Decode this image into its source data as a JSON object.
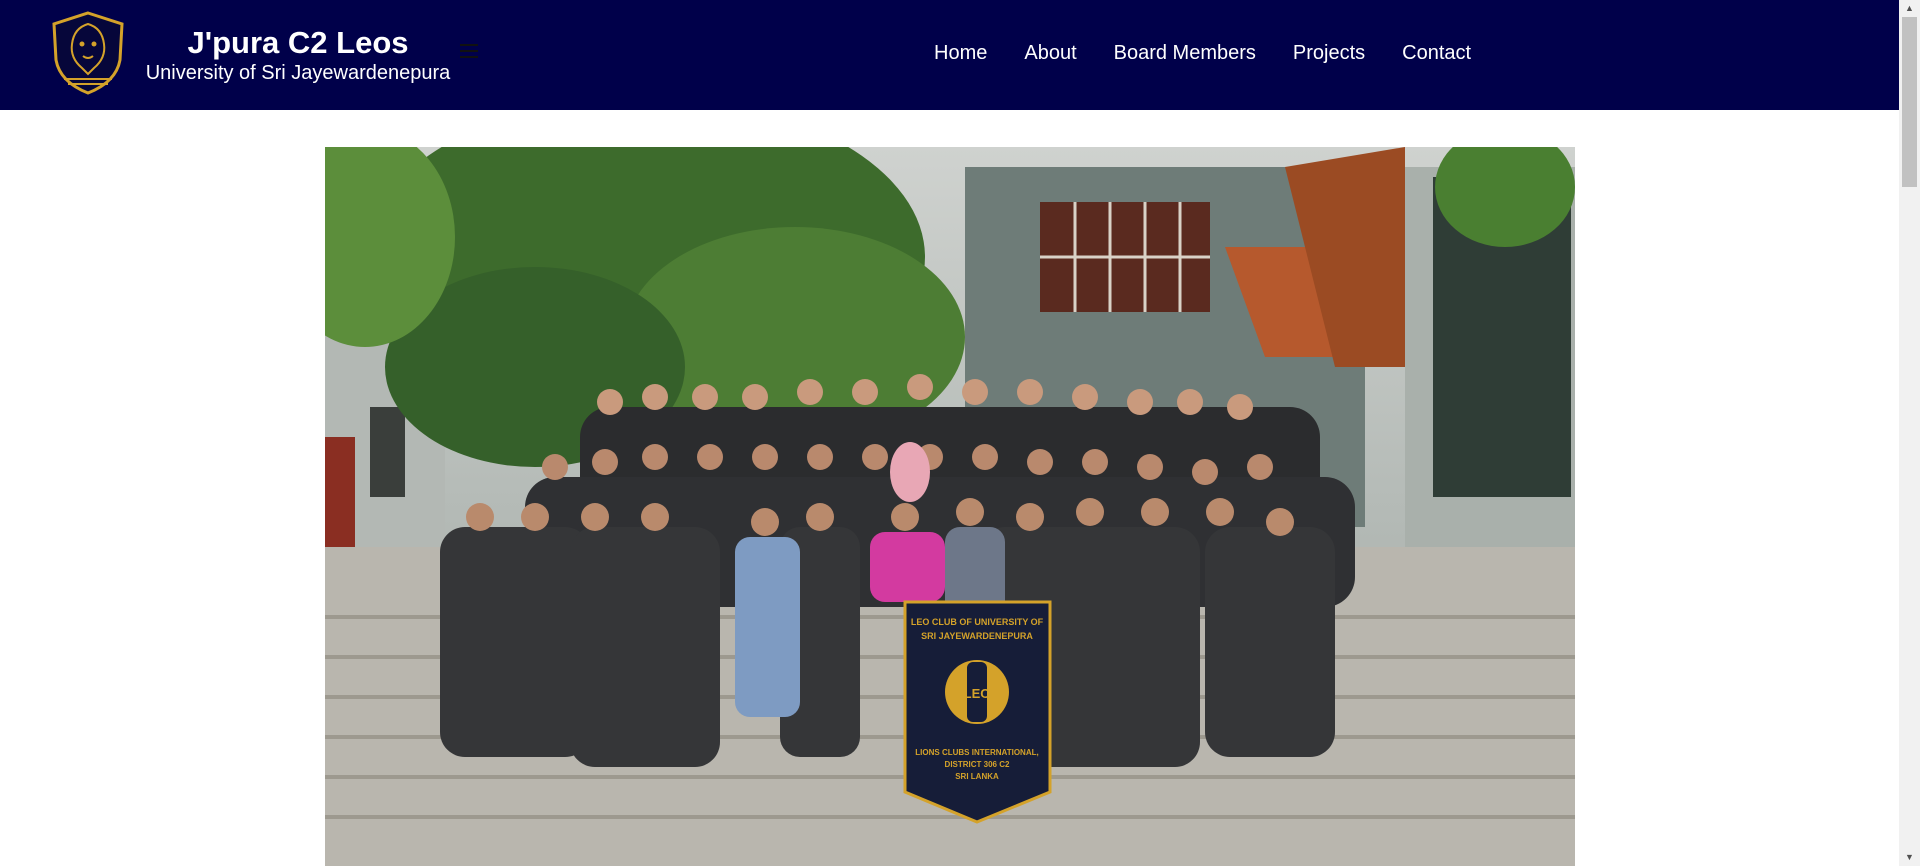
{
  "brand": {
    "title": "J'pura C2 Leos",
    "subtitle": "University of Sri Jayewardenepura",
    "logo_icon": "lion-shield-logo-icon"
  },
  "nav": {
    "items": [
      {
        "label": "Home"
      },
      {
        "label": "About"
      },
      {
        "label": "Board Members"
      },
      {
        "label": "Projects"
      },
      {
        "label": "Contact"
      }
    ]
  },
  "hero": {
    "banner_line1": "LEO CLUB OF UNIVERSITY OF",
    "banner_line2": "SRI JAYEWARDENEPURA",
    "banner_emblem": "LEO",
    "banner_line3": "LIONS CLUBS INTERNATIONAL,",
    "banner_line4": "DISTRICT 306 C2",
    "banner_line5": "SRI LANKA"
  },
  "colors": {
    "navbar": "#00004a",
    "accent_gold": "#d4a22a",
    "text_light": "#ffffff"
  }
}
